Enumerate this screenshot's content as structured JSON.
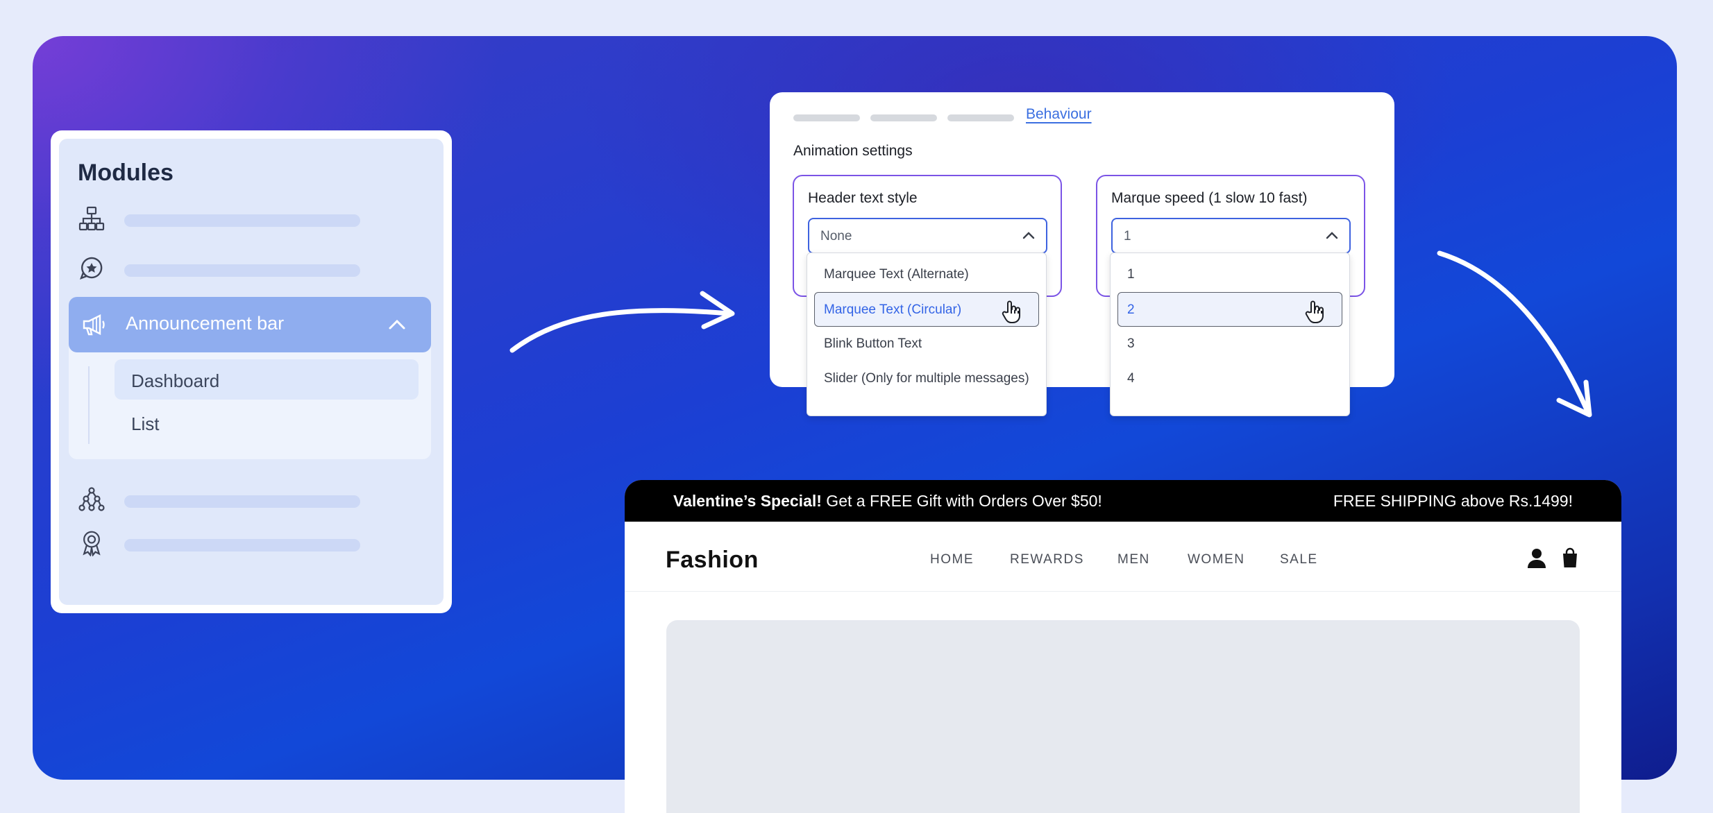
{
  "modules": {
    "title": "Modules",
    "items": [
      {
        "icon": "sitemap-icon"
      },
      {
        "icon": "star-badge-icon"
      },
      {
        "icon": "megaphone-icon",
        "label": "Announcement bar",
        "expanded": true,
        "children": [
          {
            "label": "Dashboard",
            "active": true
          },
          {
            "label": "List",
            "active": false
          }
        ]
      },
      {
        "icon": "network-icon"
      },
      {
        "icon": "award-icon"
      }
    ]
  },
  "settings": {
    "active_tab": "Behaviour",
    "section_title": "Animation settings",
    "header_text_style": {
      "label": "Header text style",
      "value": "None",
      "options": [
        "Marquee Text (Alternate)",
        "Marquee Text (Circular)",
        "Blink Button Text",
        "Slider (Only for multiple messages)"
      ],
      "highlighted": "Marquee Text (Circular)"
    },
    "marquee_speed": {
      "label": "Marque speed (1 slow 10 fast)",
      "value": "1",
      "options": [
        "1",
        "2",
        "3",
        "4"
      ],
      "highlighted": "2"
    }
  },
  "store": {
    "promo_bold": "Valentine’s Special!",
    "promo_text": " Get a FREE Gift with Orders Over $50!",
    "promo_right": "FREE SHIPPING above Rs.1499!",
    "logo": "Fashion",
    "nav": [
      "HOME",
      "REWARDS",
      "MEN",
      "WOMEN",
      "SALE"
    ]
  },
  "colors": {
    "accent": "#3b6fe0",
    "field_border": "#7b54e6",
    "highlight_text": "#3364e6",
    "sidebar_active": "#8fadef"
  }
}
